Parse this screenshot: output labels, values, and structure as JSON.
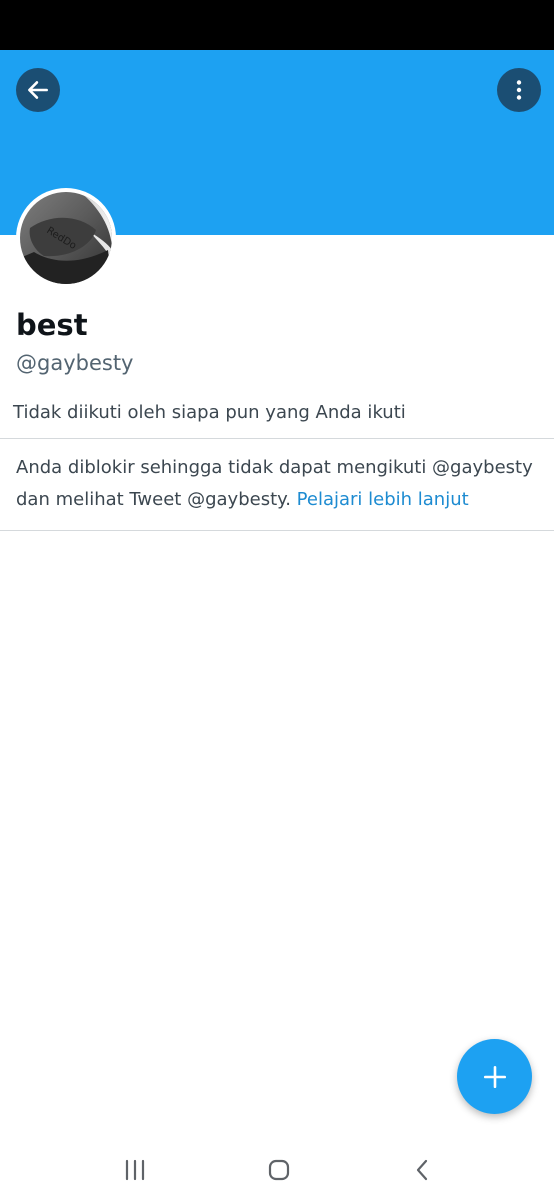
{
  "app": {
    "name": "Twitter"
  },
  "colors": {
    "banner": "#1da1f2",
    "icon_button_bg": "#1b4e73",
    "link": "#1d8bd1",
    "fab": "#1da1f2"
  },
  "header": {
    "back_icon": "arrow-left-icon",
    "more_icon": "more-vertical-icon"
  },
  "profile": {
    "display_name": "best",
    "handle": "@gaybesty",
    "followers_note": "Tidak diikuti oleh siapa pun yang Anda ikuti"
  },
  "blocked": {
    "message": "Anda diblokir sehingga tidak dapat mengikuti @gaybesty dan melihat Tweet @gaybesty.",
    "link_label": "Pelajari lebih lanjut"
  },
  "fab": {
    "icon": "plus-icon"
  },
  "system_nav": {
    "recents_icon": "recents-icon",
    "home_icon": "home-icon",
    "back_icon": "back-chevron-icon"
  }
}
